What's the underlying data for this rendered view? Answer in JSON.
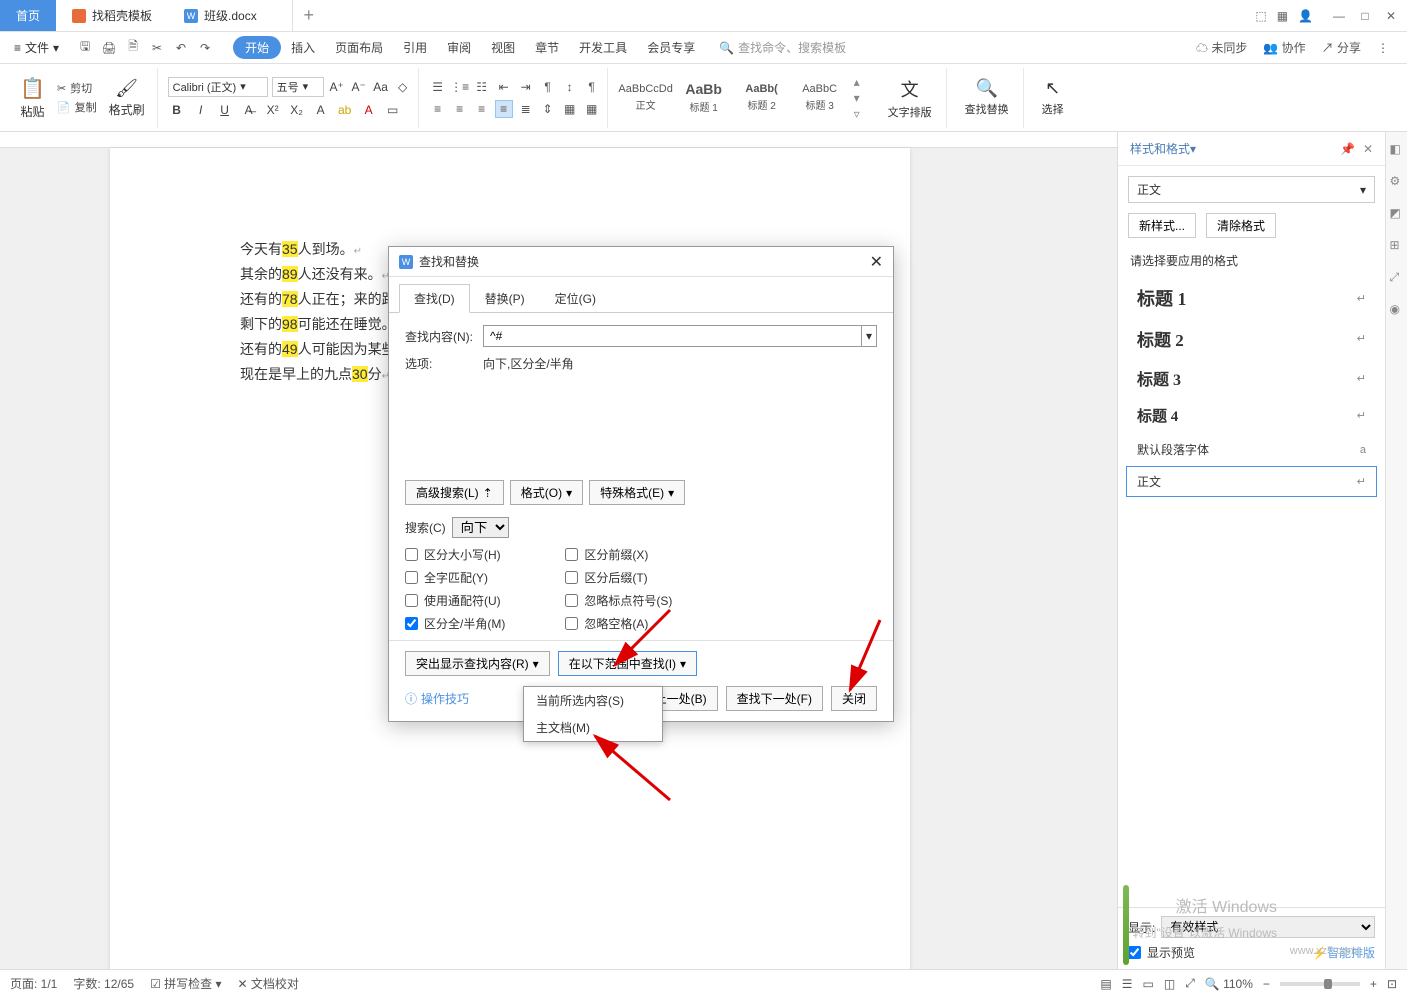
{
  "titlebar": {
    "home": "首页",
    "template": "找稻壳模板",
    "doc": "班级.docx",
    "add": "+"
  },
  "win": {
    "min": "—",
    "max": "□",
    "close": "✕"
  },
  "menubar": {
    "file": "文件",
    "tabs": [
      "开始",
      "插入",
      "页面布局",
      "引用",
      "审阅",
      "视图",
      "章节",
      "开发工具",
      "会员专享"
    ],
    "search_placeholder": "查找命令、搜索模板",
    "unsync": "未同步",
    "coop": "协作",
    "share": "分享"
  },
  "ribbon": {
    "paste": "粘贴",
    "cut": "剪切",
    "copy": "复制",
    "painter": "格式刷",
    "font": "Calibri (正文)",
    "size": "五号",
    "styles": [
      {
        "preview": "AaBbCcDd",
        "name": "正文"
      },
      {
        "preview": "AaBb",
        "name": "标题 1"
      },
      {
        "preview": "AaBb(",
        "name": "标题 2"
      },
      {
        "preview": "AaBbC",
        "name": "标题 3"
      }
    ],
    "text_layout": "文字排版",
    "find_replace": "查找替换",
    "select": "选择"
  },
  "doc": {
    "lines": [
      {
        "pre": "今天有 ",
        "hl": "35",
        "post": " 人到场。"
      },
      {
        "pre": "其余的 ",
        "hl": "89",
        "post": " 人还没有来。"
      },
      {
        "pre": "还有的 ",
        "hl": "78",
        "post": " 人正在；来的路"
      },
      {
        "pre": "剩下的 ",
        "hl": "98",
        "post": " 可能还在睡觉。"
      },
      {
        "pre": "还有的 ",
        "hl": "49",
        "post": " 人可能因为某些"
      },
      {
        "pre": "现在是早上的九点 ",
        "hl": "30",
        "post": " 分"
      }
    ]
  },
  "dialog": {
    "title": "查找和替换",
    "tabs": [
      "查找(D)",
      "替换(P)",
      "定位(G)"
    ],
    "find_label": "查找内容(N):",
    "find_value": "^#",
    "options_label": "选项:",
    "options_value": "向下,区分全/半角",
    "adv": "高级搜索(L)",
    "format": "格式(O)",
    "special": "特殊格式(E)",
    "search_label": "搜索(C)",
    "search_dir": "向下",
    "checks_left": [
      "区分大小写(H)",
      "全字匹配(Y)",
      "使用通配符(U)",
      "区分全/半角(M)"
    ],
    "checks_right": [
      "区分前缀(X)",
      "区分后缀(T)",
      "忽略标点符号(S)",
      "忽略空格(A)"
    ],
    "highlight": "突出显示查找内容(R)",
    "find_in": "在以下范围中查找(I)",
    "tips": "操作技巧",
    "find_prev": "查找上一处(B)",
    "find_next": "查找下一处(F)",
    "close": "关闭",
    "dd": [
      "当前所选内容(S)",
      "主文档(M)"
    ]
  },
  "side": {
    "title": "样式和格式",
    "current": "正文",
    "new": "新样式...",
    "clear": "清除格式",
    "instruction": "请选择要应用的格式",
    "entries": [
      {
        "label": "标题 1",
        "cls": "h1"
      },
      {
        "label": "标题 2",
        "cls": "h2"
      },
      {
        "label": "标题 3",
        "cls": "h3"
      },
      {
        "label": "标题 4",
        "cls": "h4"
      },
      {
        "label": "默认段落字体",
        "cls": ""
      },
      {
        "label": "正文",
        "cls": ""
      }
    ],
    "show_label": "显示:",
    "show_value": "有效样式",
    "preview": "显示预览",
    "smart": "智能排版"
  },
  "status": {
    "page": "页面: 1/1",
    "words": "字数: 12/65",
    "spell": "拼写检查",
    "proof": "文档校对",
    "zoom": "110%"
  },
  "wm": {
    "activate": "激活 Windows",
    "goto": "转到\"设置\"以激活 Windows",
    "site": "www.xz7.com"
  }
}
